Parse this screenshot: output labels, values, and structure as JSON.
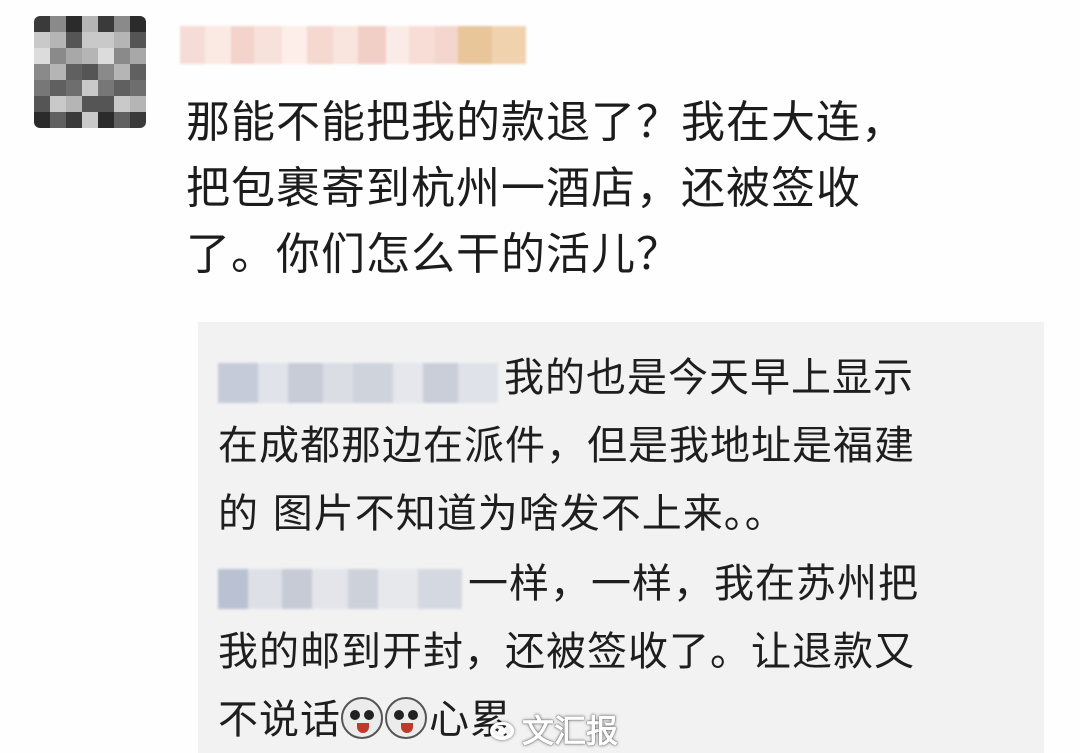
{
  "comment": {
    "lines": [
      "那能不能把我的款退了？我在大连，",
      "把包裹寄到杭州一酒店，还被签收",
      "了。你们怎么干的活儿？"
    ]
  },
  "replies": [
    {
      "lines": [
        "我的也是今天早上显示",
        "在成都那边在派件，但是我地址是福建",
        "的 图片不知道为啥发不上来。。"
      ]
    },
    {
      "lines": [
        "一样，一样，我在苏州把",
        "我的邮到开封，还被签收了。让退款又",
        "不说话",
        "心累"
      ],
      "emoji_icons": [
        "laughing-dog-emoji-icon",
        "laughing-dog-emoji-icon"
      ]
    }
  ],
  "watermark": {
    "text": "文汇报",
    "logo": "weibo-logo-icon"
  },
  "colors": {
    "text": "#1c1c1c",
    "reply_background": "#f2f2f3"
  }
}
